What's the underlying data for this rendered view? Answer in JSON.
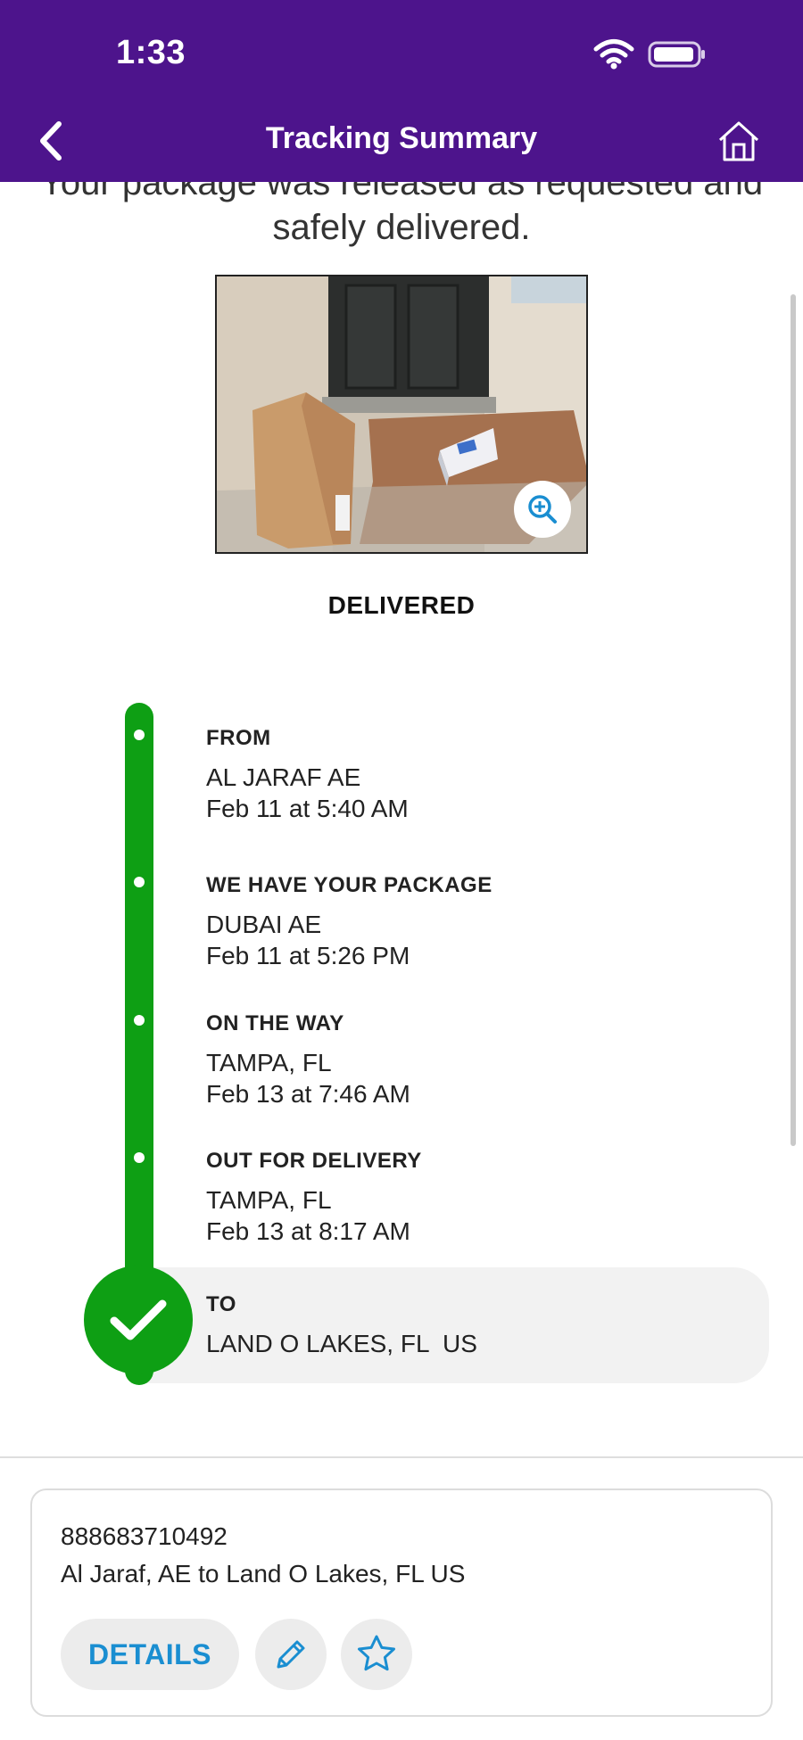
{
  "status_bar": {
    "time": "1:33"
  },
  "header": {
    "title": "Tracking Summary"
  },
  "message": {
    "line1": "Your package was released as requested and",
    "line2": "safely delivered."
  },
  "status": "DELIVERED",
  "timeline": [
    {
      "label": "FROM",
      "location": "AL JARAF AE",
      "time": "Feb 11 at 5:40 AM"
    },
    {
      "label": "WE HAVE YOUR PACKAGE",
      "location": "DUBAI AE",
      "time": "Feb 11 at 5:26 PM"
    },
    {
      "label": "ON THE WAY",
      "location": "TAMPA, FL",
      "time": "Feb 13 at 7:46 AM"
    },
    {
      "label": "OUT FOR DELIVERY",
      "location": "TAMPA, FL",
      "time": "Feb 13 at 8:17 AM"
    },
    {
      "label": "TO",
      "location": "LAND O LAKES, FL  US"
    }
  ],
  "shipment_card": {
    "tracking_number": "888683710492",
    "route": "Al Jaraf, AE to Land O Lakes, FL US",
    "details_label": "DETAILS"
  },
  "colors": {
    "brand_purple": "#4d148c",
    "timeline_green": "#0e9f14",
    "link_blue": "#1a8ed1"
  },
  "icons": [
    "back-chevron-icon",
    "home-icon",
    "wifi-icon",
    "battery-icon",
    "zoom-in-icon",
    "checkmark-icon",
    "pencil-icon",
    "star-icon"
  ]
}
